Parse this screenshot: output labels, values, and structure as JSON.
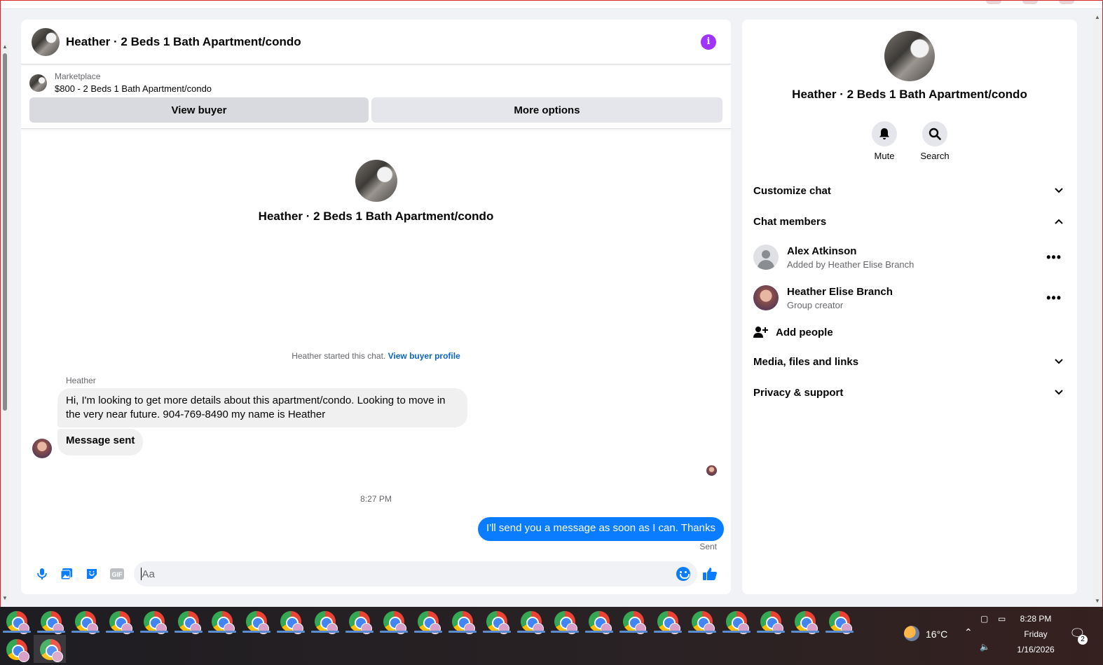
{
  "chat": {
    "title": "Heather · 2 Beds 1 Bath Apartment/condo",
    "marketplace_label": "Marketplace",
    "listing": "$800 - 2 Beds 1 Bath Apartment/condo",
    "view_buyer": "View buyer",
    "more_options": "More options",
    "intro_title": "Heather · 2 Beds 1 Bath Apartment/condo",
    "started_text": "Heather started this chat.",
    "view_buyer_profile": "View buyer profile",
    "sender_name": "Heather",
    "message_1": "Hi, I'm looking to get more details about this  apartment/condo. Looking to move in the very near future. 904-769-8490 my name is Heather",
    "message_2": "Message sent",
    "timestamp": "8:27 PM",
    "outgoing_message": "I'll send you a message as soon as I can. Thanks",
    "sent_status": "Sent",
    "composer_placeholder": "Aa"
  },
  "info_panel": {
    "title": "Heather · 2 Beds 1 Bath Apartment/condo",
    "mute_label": "Mute",
    "search_label": "Search",
    "customize_chat": "Customize chat",
    "chat_members": "Chat members",
    "members": [
      {
        "name": "Alex Atkinson",
        "sub": "Added by Heather Elise Branch"
      },
      {
        "name": "Heather Elise Branch",
        "sub": "Group creator"
      }
    ],
    "add_people": "Add people",
    "media_files_links": "Media, files and links",
    "privacy_support": "Privacy & support"
  },
  "taskbar": {
    "temperature": "16°C",
    "time": "8:28 PM",
    "day": "Friday",
    "date": "1/16/2026",
    "notification_count": "2"
  },
  "colors": {
    "accent_blue": "#0a7cff",
    "info_purple": "#a033ff",
    "link_blue": "#0a66c2"
  }
}
